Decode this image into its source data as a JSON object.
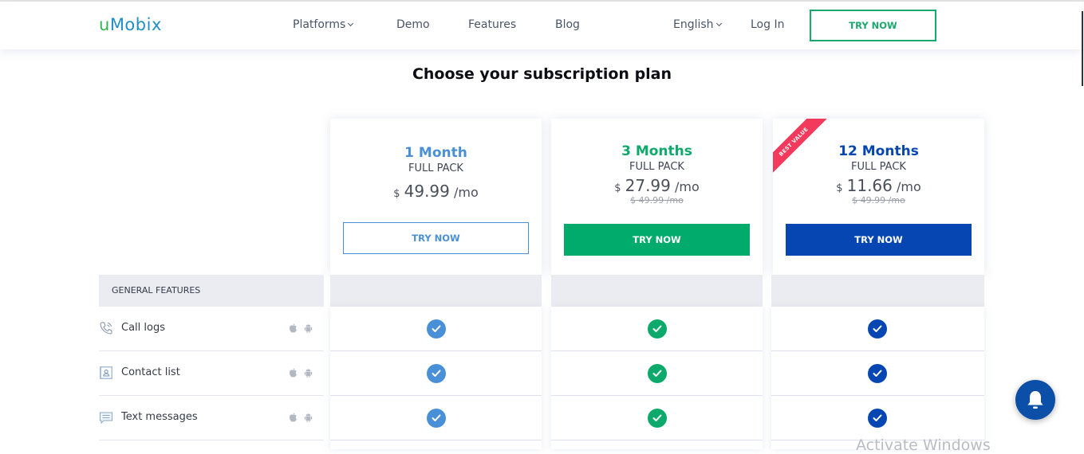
{
  "header": {
    "logo_u": "u",
    "logo_rest": "Mobix",
    "nav": [
      {
        "label": "Platforms",
        "has_dropdown": true
      },
      {
        "label": "Demo",
        "has_dropdown": false
      },
      {
        "label": "Features",
        "has_dropdown": false
      },
      {
        "label": "Blog",
        "has_dropdown": false
      }
    ],
    "language": "English",
    "login": "Log In",
    "try_now": "TRY NOW"
  },
  "page_title": "Choose your subscription plan",
  "plans": [
    {
      "name": "1 Month",
      "sub": "FULL PACK",
      "currency": "$",
      "price": "49.99",
      "period": "/mo",
      "old_price": "",
      "button": "TRY NOW",
      "color": "#4a90d9",
      "ribbon": ""
    },
    {
      "name": "3 Months",
      "sub": "FULL PACK",
      "currency": "$",
      "price": "27.99",
      "period": "/mo",
      "old_price": "$ 49.99 /mo",
      "button": "TRY NOW",
      "color": "#0eaa6b",
      "ribbon": ""
    },
    {
      "name": "12 Months",
      "sub": "FULL PACK",
      "currency": "$",
      "price": "11.66",
      "period": "/mo",
      "old_price": "$ 49.99 /mo",
      "button": "TRY NOW",
      "color": "#0646b3",
      "ribbon": "BEST VALUE"
    }
  ],
  "features": {
    "section_title": "GENERAL FEATURES",
    "rows": [
      {
        "label": "Call logs",
        "icon": "phone-icon",
        "platforms": [
          "apple-icon",
          "android-icon"
        ],
        "included": [
          true,
          true,
          true
        ]
      },
      {
        "label": "Contact list",
        "icon": "contact-icon",
        "platforms": [
          "apple-icon",
          "android-icon"
        ],
        "included": [
          true,
          true,
          true
        ]
      },
      {
        "label": "Text messages",
        "icon": "message-icon",
        "platforms": [
          "apple-icon",
          "android-icon"
        ],
        "included": [
          true,
          true,
          true
        ]
      }
    ]
  },
  "watermark": "Activate Windows",
  "colors": {
    "green": "#19a96c",
    "blue_light": "#4a90d9",
    "blue_dark": "#0646b3",
    "ribbon": "#f33a5c"
  }
}
